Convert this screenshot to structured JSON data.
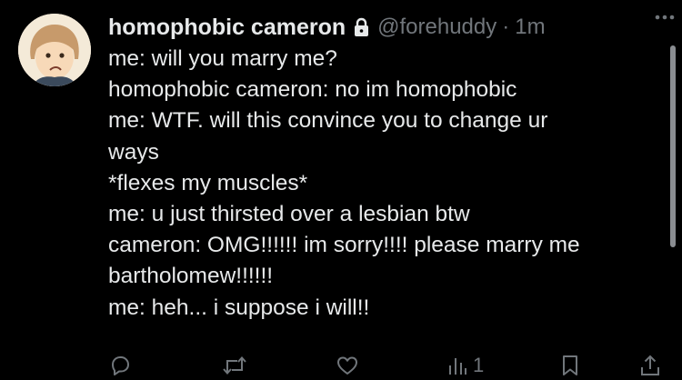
{
  "tweet": {
    "author_name": "homophobic cameron",
    "handle": "@forehuddy",
    "separator": "·",
    "time": "1m",
    "lines": [
      "me: will you marry me?",
      "homophobic cameron: no im homophobic",
      "me: WTF. will this convince you to change ur",
      "ways",
      "*flexes my muscles*",
      "me: u just thirsted over a lesbian btw",
      "cameron: OMG!!!!!! im sorry!!!! please marry me",
      "bartholomew!!!!!!",
      "me: heh... i suppose i will!!"
    ]
  },
  "actions": {
    "views_count": "1"
  },
  "icons": {
    "lock": "lock-icon",
    "more": "more-icon",
    "reply": "reply-icon",
    "retweet": "retweet-icon",
    "like": "like-icon",
    "views": "views-icon",
    "bookmark": "bookmark-icon",
    "share": "share-icon"
  },
  "colors": {
    "background": "#000000",
    "text": "#e7e9ea",
    "muted": "#71767b"
  }
}
